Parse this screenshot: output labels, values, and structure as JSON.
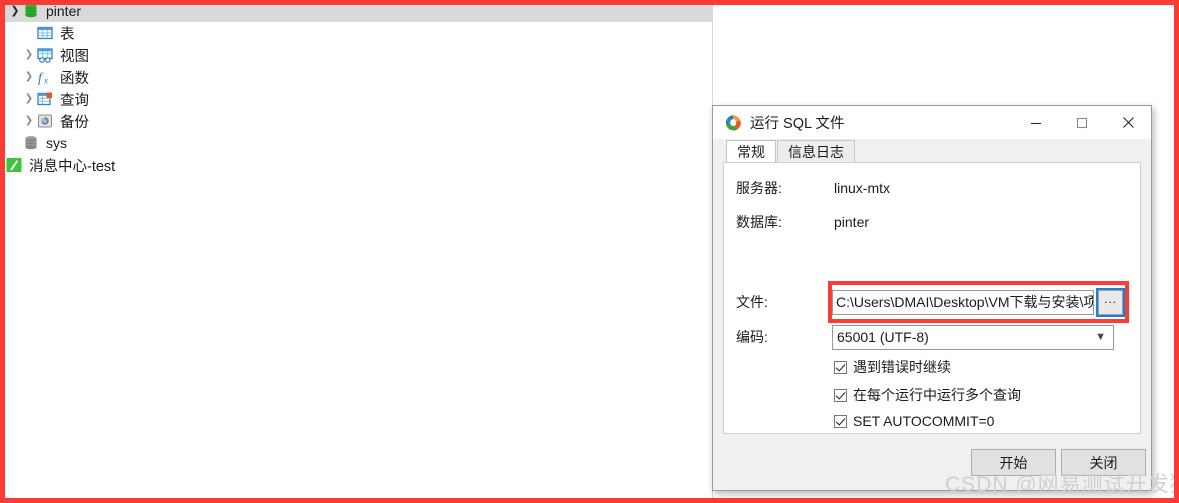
{
  "tree": {
    "items": [
      {
        "label": "pinter",
        "icon": "database-icon",
        "twisty": "open",
        "indent": 0,
        "selected": true
      },
      {
        "label": "表",
        "icon": "table-icon",
        "twisty": "none",
        "indent": 1,
        "selected": false
      },
      {
        "label": "视图",
        "icon": "view-icon",
        "twisty": "collapsed",
        "indent": 1,
        "selected": false
      },
      {
        "label": "函数",
        "icon": "function-icon",
        "twisty": "collapsed",
        "indent": 1,
        "selected": false
      },
      {
        "label": "查询",
        "icon": "query-icon",
        "twisty": "collapsed",
        "indent": 1,
        "selected": false
      },
      {
        "label": "备份",
        "icon": "backup-icon",
        "twisty": "collapsed",
        "indent": 1,
        "selected": false
      },
      {
        "label": "sys",
        "icon": "database-icon",
        "twisty": "none",
        "indent": 0,
        "selected": false
      },
      {
        "label": "消息中心-test",
        "icon": "connection-icon",
        "twisty": "none",
        "indent": -1,
        "selected": false
      }
    ]
  },
  "dialog": {
    "title": "运行 SQL 文件",
    "title_icon": "navicat-icon",
    "window_controls": {
      "minimize": "minimize-icon",
      "maximize": "maximize-icon",
      "close": "close-icon"
    },
    "tabs": [
      {
        "label": "常规",
        "active": true
      },
      {
        "label": "信息日志",
        "active": false
      }
    ],
    "form": {
      "server_label": "服务器:",
      "server_value": "linux-mtx",
      "database_label": "数据库:",
      "database_value": "pinter",
      "file_label": "文件:",
      "file_value": "C:\\Users\\DMAI\\Desktop\\VM下载与安装\\项",
      "browse_button": "...",
      "encoding_label": "编码:",
      "encoding_value": "65001 (UTF-8)"
    },
    "checkboxes": [
      {
        "label": "遇到错误时继续",
        "checked": true
      },
      {
        "label": "在每个运行中运行多个查询",
        "checked": true
      },
      {
        "label": "SET AUTOCOMMIT=0",
        "checked": true
      }
    ],
    "buttons": {
      "start": "开始",
      "close": "关闭"
    }
  },
  "watermark": "CSDN @网易测试开发猿",
  "colors": {
    "annotation_red": "#fb3b36",
    "selection_gray": "#d9d9d9",
    "dialog_bg": "#f0f0f0",
    "focus_blue": "#1f7fd4"
  }
}
